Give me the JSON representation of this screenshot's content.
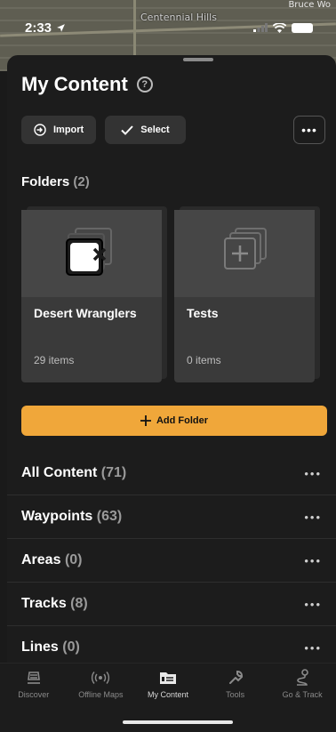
{
  "status": {
    "time": "2:33"
  },
  "map": {
    "label": "Centennial Hills",
    "corner_label": "Bruce Wo"
  },
  "header": {
    "title": "My Content"
  },
  "actions": {
    "import_label": "Import",
    "select_label": "Select"
  },
  "folders": {
    "heading": "Folders",
    "count": "(2)",
    "items": [
      {
        "name": "Desert Wranglers",
        "count": "29 items"
      },
      {
        "name": "Tests",
        "count": "0 items"
      }
    ],
    "add_label": "Add Folder"
  },
  "lists": [
    {
      "label": "All Content",
      "count": "(71)"
    },
    {
      "label": "Waypoints",
      "count": "(63)"
    },
    {
      "label": "Areas",
      "count": "(0)"
    },
    {
      "label": "Tracks",
      "count": "(8)"
    },
    {
      "label": "Lines",
      "count": "(0)"
    }
  ],
  "tabs": [
    {
      "label": "Discover",
      "icon": "discover-icon"
    },
    {
      "label": "Offline Maps",
      "icon": "offline-maps-icon"
    },
    {
      "label": "My Content",
      "icon": "my-content-icon",
      "active": true
    },
    {
      "label": "Tools",
      "icon": "tools-icon"
    },
    {
      "label": "Go & Track",
      "icon": "go-track-icon"
    }
  ],
  "colors": {
    "accent": "#f0a73a",
    "sheet": "#1c1c1c"
  }
}
